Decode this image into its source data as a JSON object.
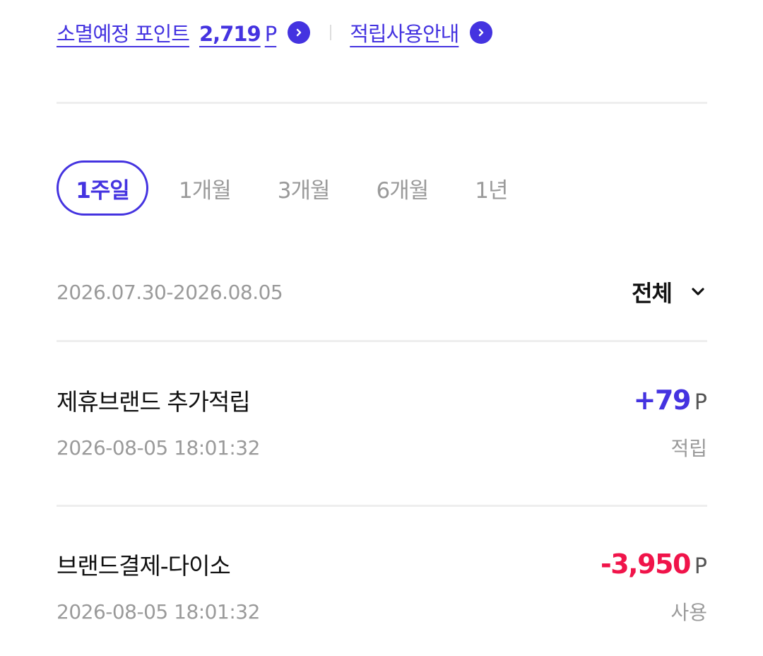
{
  "expiring": {
    "label": "소멸예정 포인트",
    "amount": "2,719",
    "unit": "P"
  },
  "guide": {
    "label": "적립사용안내"
  },
  "period_tabs": [
    {
      "label": "1주일",
      "active": true
    },
    {
      "label": "1개월",
      "active": false
    },
    {
      "label": "3개월",
      "active": false
    },
    {
      "label": "6개월",
      "active": false
    },
    {
      "label": "1년",
      "active": false
    }
  ],
  "date_range": "2026.07.30-2026.08.05",
  "filter": {
    "selected": "전체"
  },
  "transactions": [
    {
      "title": "제휴브랜드 추가적립",
      "amount": "+79",
      "unit": "P",
      "datetime": "2026-08-05 18:01:32",
      "type": "적립"
    },
    {
      "title": "브랜드결제-다이소",
      "amount": "-3,950",
      "unit": "P",
      "datetime": "2026-08-05 18:01:32",
      "type": "사용"
    }
  ],
  "colors": {
    "accent": "#4433e0",
    "negative": "#f0144a",
    "muted": "#9a9a9a"
  }
}
